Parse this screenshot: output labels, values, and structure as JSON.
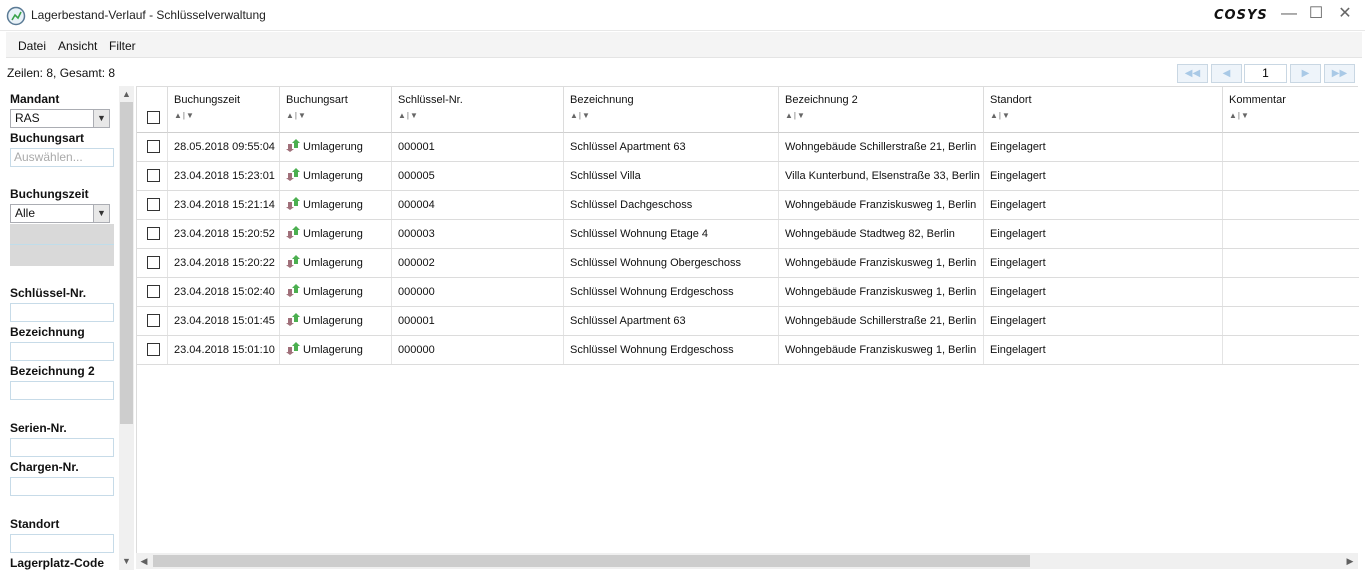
{
  "window": {
    "title": "Lagerbestand-Verlauf - Schlüsselverwaltung",
    "brand": "COSYS",
    "minimize": "—",
    "maximize": "☐",
    "close": "✕"
  },
  "menu": [
    "Datei",
    "Ansicht",
    "Filter"
  ],
  "info": {
    "rows_text": "Zeilen: 8, Gesamt: 8"
  },
  "pager": {
    "first": "◀◀",
    "prev": "◀",
    "page": "1",
    "next": "▶",
    "last": "▶▶"
  },
  "filters": {
    "mandant_label": "Mandant",
    "mandant_value": "RAS",
    "buchungsart_label": "Buchungsart",
    "buchungsart_placeholder": "Auswählen...",
    "buchungszeit_label": "Buchungszeit",
    "buchungszeit_value": "Alle",
    "schluessel_label": "Schlüssel-Nr.",
    "bezeichnung_label": "Bezeichnung",
    "bezeichnung2_label": "Bezeichnung 2",
    "serien_label": "Serien-Nr.",
    "chargen_label": "Chargen-Nr.",
    "standort_label": "Standort",
    "lagerplatz_label": "Lagerplatz-Code"
  },
  "grid": {
    "columns": [
      "Buchungszeit",
      "Buchungsart",
      "Schlüssel-Nr.",
      "Bezeichnung",
      "Bezeichnung 2",
      "Standort",
      "Kommentar"
    ],
    "sort_glyph": "▲|▼",
    "rows": [
      [
        "28.05.2018 09:55:04",
        "Umlagerung",
        "000001",
        "Schlüssel Apartment 63",
        "Wohngebäude Schillerstraße 21, Berlin",
        "Eingelagert",
        ""
      ],
      [
        "23.04.2018 15:23:01",
        "Umlagerung",
        "000005",
        "Schlüssel Villa",
        "Villa Kunterbund, Elsenstraße 33, Berlin",
        "Eingelagert",
        ""
      ],
      [
        "23.04.2018 15:21:14",
        "Umlagerung",
        "000004",
        "Schlüssel Dachgeschoss",
        "Wohngebäude Franziskusweg 1, Berlin",
        "Eingelagert",
        ""
      ],
      [
        "23.04.2018 15:20:52",
        "Umlagerung",
        "000003",
        "Schlüssel Wohnung Etage 4",
        "Wohngebäude Stadtweg 82, Berlin",
        "Eingelagert",
        ""
      ],
      [
        "23.04.2018 15:20:22",
        "Umlagerung",
        "000002",
        "Schlüssel Wohnung Obergeschoss",
        "Wohngebäude Franziskusweg 1, Berlin",
        "Eingelagert",
        ""
      ],
      [
        "23.04.2018 15:02:40",
        "Umlagerung",
        "000000",
        "Schlüssel Wohnung Erdgeschoss",
        "Wohngebäude Franziskusweg 1, Berlin",
        "Eingelagert",
        ""
      ],
      [
        "23.04.2018 15:01:45",
        "Umlagerung",
        "000001",
        "Schlüssel Apartment 63",
        "Wohngebäude Schillerstraße 21, Berlin",
        "Eingelagert",
        ""
      ],
      [
        "23.04.2018 15:01:10",
        "Umlagerung",
        "000000",
        "Schlüssel Wohnung Erdgeschoss",
        "Wohngebäude Franziskusweg 1, Berlin",
        "Eingelagert",
        ""
      ]
    ]
  },
  "colors": {
    "accent": "#a9c9e6",
    "icon_up": "#4caf50",
    "icon_down": "#a0707a"
  }
}
